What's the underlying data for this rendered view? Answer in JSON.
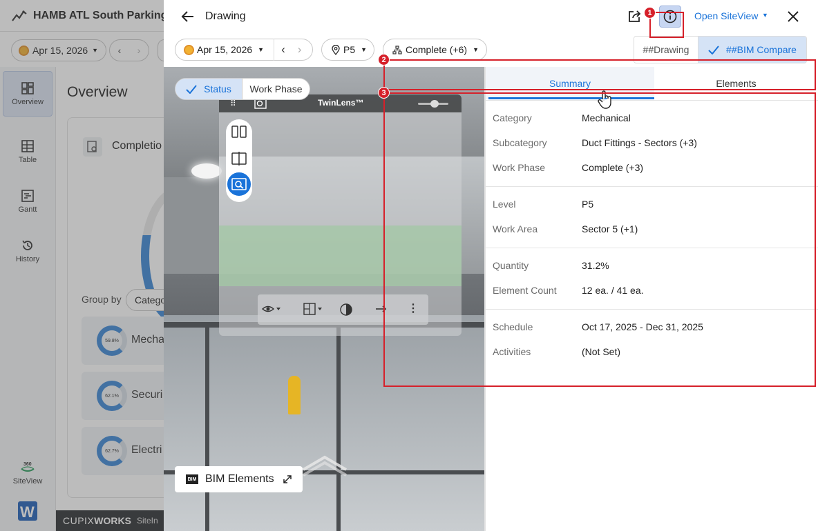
{
  "background_app": {
    "project_title": "HAMB ATL South Parking",
    "date": "Apr 15, 2026",
    "nav": [
      {
        "label": "Overview"
      },
      {
        "label": "Table"
      },
      {
        "label": "Gantt"
      },
      {
        "label": "History"
      },
      {
        "label": "SiteView"
      }
    ],
    "page_title": "Overview",
    "card_title": "Completio",
    "group_by_label": "Group by",
    "group_by_value": "Catego",
    "items": [
      {
        "pct": "59.8%",
        "label": "Mecha"
      },
      {
        "pct": "62.1%",
        "label": "Securi"
      },
      {
        "pct": "62.7%",
        "label": "Electri"
      }
    ],
    "footer_brand_a": "CUPIX",
    "footer_brand_b": "WORKS",
    "footer_siteinsights": "SiteIn"
  },
  "drawer": {
    "title": "Drawing",
    "open_siteview": "Open SiteView",
    "date": "Apr 15, 2026",
    "level": "P5",
    "status_filter": "Complete (+6)",
    "view_toggle": {
      "drawing": "##Drawing",
      "bim_compare": "##BIM Compare"
    },
    "viewer": {
      "toggle_status": "Status",
      "toggle_work_phase": "Work Phase",
      "twinlens_title": "TwinLens™",
      "bim_elements": "BIM Elements",
      "bim_badge": "BIM",
      "highlight_color": "#6bb86b"
    },
    "tabs": {
      "summary": "Summary",
      "elements": "Elements"
    },
    "summary": {
      "category": {
        "label": "Category",
        "value": "Mechanical"
      },
      "subcategory": {
        "label": "Subcategory",
        "value": "Duct Fittings - Sectors (+3)"
      },
      "work_phase": {
        "label": "Work Phase",
        "value": "Complete (+3)"
      },
      "level": {
        "label": "Level",
        "value": "P5"
      },
      "work_area": {
        "label": "Work Area",
        "value": "Sector 5 (+1)"
      },
      "quantity": {
        "label": "Quantity",
        "value": "31.2%"
      },
      "element_count": {
        "label": "Element Count",
        "value": "12 ea. / 41 ea."
      },
      "schedule": {
        "label": "Schedule",
        "value": "Oct 17, 2025 - Dec 31, 2025"
      },
      "activities": {
        "label": "Activities",
        "value": "(Not Set)"
      }
    },
    "annotations": [
      "1",
      "2",
      "3"
    ]
  },
  "colors": {
    "accent": "#1a73d9",
    "annotation_red": "#d6202a",
    "ring_blue": "#3a86d6"
  }
}
